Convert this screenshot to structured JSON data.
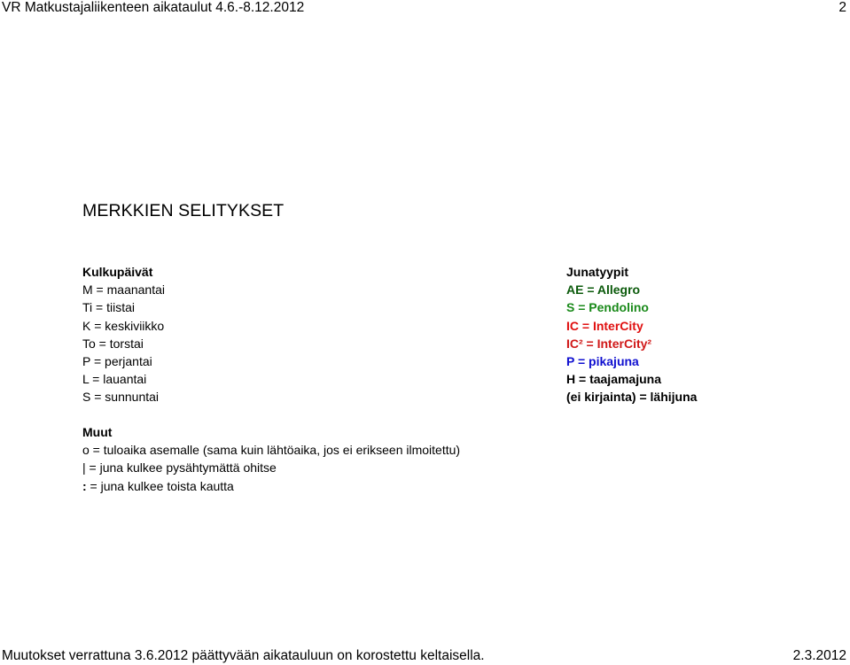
{
  "header": {
    "title": "VR Matkustajaliikenteen aikataulut 4.6.-8.12.2012",
    "page_number": "2"
  },
  "main": {
    "heading": "MERKKIEN SELITYKSET",
    "operating_days": {
      "title": "Kulkupäivät",
      "items": [
        "M = maanantai",
        "Ti = tiistai",
        "K = keskiviikko",
        "To = torstai",
        "P = perjantai",
        "L = lauantai",
        "S = sunnuntai"
      ]
    },
    "train_types": {
      "title": "Junatyypit",
      "items": [
        {
          "text": "AE = Allegro",
          "color": "#0b5a0b"
        },
        {
          "text": "S = Pendolino",
          "color": "#1a8a1a"
        },
        {
          "text": "IC = InterCity",
          "color": "#e01010"
        },
        {
          "text": "IC² = InterCity²",
          "color": "#d01818"
        },
        {
          "text": "P = pikajuna",
          "color": "#1010d0"
        },
        {
          "text": "H = taajamajuna",
          "color": "#000000"
        },
        {
          "text": "(ei kirjainta) = lähijuna",
          "color": "#000000"
        }
      ]
    },
    "other": {
      "title": "Muut",
      "items": [
        {
          "symbol": "o",
          "text": " = tuloaika asemalle (sama kuin lähtöaika, jos ei erikseen ilmoitettu)"
        },
        {
          "symbol": "|",
          "text": " = juna kulkee pysähtymättä ohitse"
        },
        {
          "symbol": ":",
          "text": " = juna kulkee toista kautta"
        }
      ]
    }
  },
  "footer": {
    "note": "Muutokset verrattuna 3.6.2012 päättyvään aikatauluun on korostettu keltaisella.",
    "date": "2.3.2012"
  }
}
